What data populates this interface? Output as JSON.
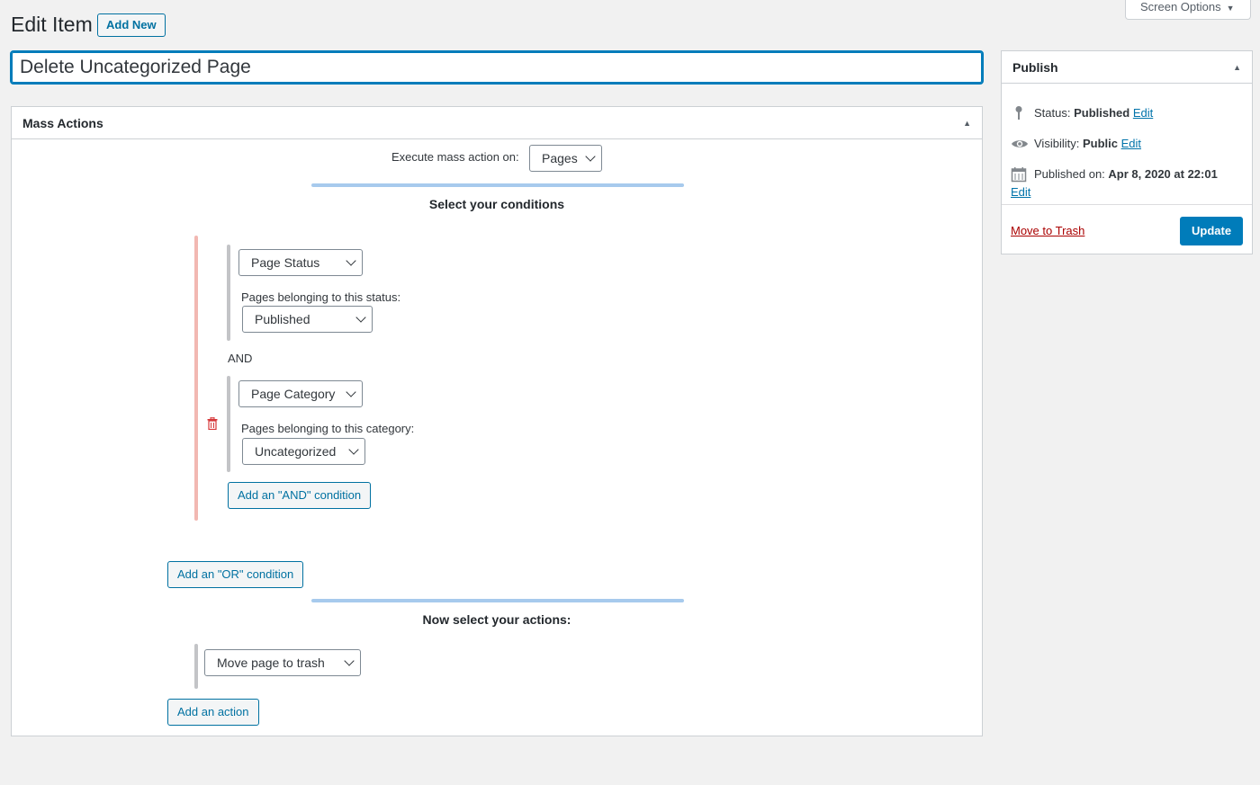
{
  "header": {
    "title": "Edit Item",
    "add_new": "Add New",
    "screen_options": "Screen Options"
  },
  "post_title": "Delete Uncategorized Page",
  "mass_actions": {
    "panel_title": "Mass Actions",
    "execute_label": "Execute mass action on:",
    "execute_value": "Pages",
    "conditions_heading": "Select your conditions",
    "conditions": [
      {
        "type": "Page Status",
        "sub_label": "Pages belonging to this status:",
        "sub_value": "Published"
      },
      {
        "type": "Page Category",
        "sub_label": "Pages belonging to this category:",
        "sub_value": "Uncategorized"
      }
    ],
    "and_text": "AND",
    "add_and": "Add an \"AND\" condition",
    "add_or": "Add an \"OR\" condition",
    "actions_heading": "Now select your actions:",
    "action_value": "Move page to trash",
    "add_action": "Add an action"
  },
  "publish": {
    "title": "Publish",
    "status_label": "Status:",
    "status_value": "Published",
    "visibility_label": "Visibility:",
    "visibility_value": "Public",
    "published_label": "Published on:",
    "published_value": "Apr 8, 2020 at 22:01",
    "edit": "Edit",
    "move_to_trash": "Move to Trash",
    "update": "Update"
  },
  "colors": {
    "accent": "#007cba",
    "link": "#0073aa",
    "danger": "#a00",
    "or_bar": "#f2b8b2",
    "rule": "#a7caed"
  }
}
